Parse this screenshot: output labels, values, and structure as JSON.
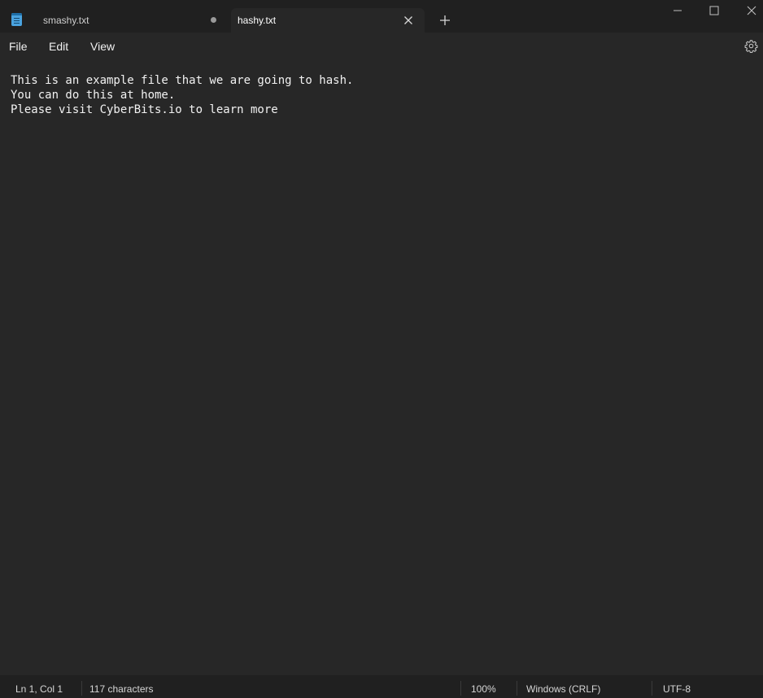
{
  "tabs": [
    {
      "label": "smashy.txt",
      "modified": true,
      "active": false
    },
    {
      "label": "hashy.txt",
      "modified": false,
      "active": true
    }
  ],
  "icons": {
    "app": "notepad-icon",
    "close_tab": "close-icon",
    "new_tab": "plus-icon",
    "minimize": "minimize-icon",
    "maximize": "maximize-icon",
    "close_window": "close-icon",
    "settings": "gear-icon"
  },
  "menu": {
    "file": "File",
    "edit": "Edit",
    "view": "View"
  },
  "editor": {
    "content": "This is an example file that we are going to hash.\nYou can do this at home.\nPlease visit CyberBits.io to learn more"
  },
  "status": {
    "position": "Ln 1, Col 1",
    "characters": "117 characters",
    "zoom": "100%",
    "line_ending": "Windows (CRLF)",
    "encoding": "UTF-8"
  },
  "colors": {
    "background": "#272727",
    "titlebar": "#202020",
    "text": "#f2f2f2"
  }
}
